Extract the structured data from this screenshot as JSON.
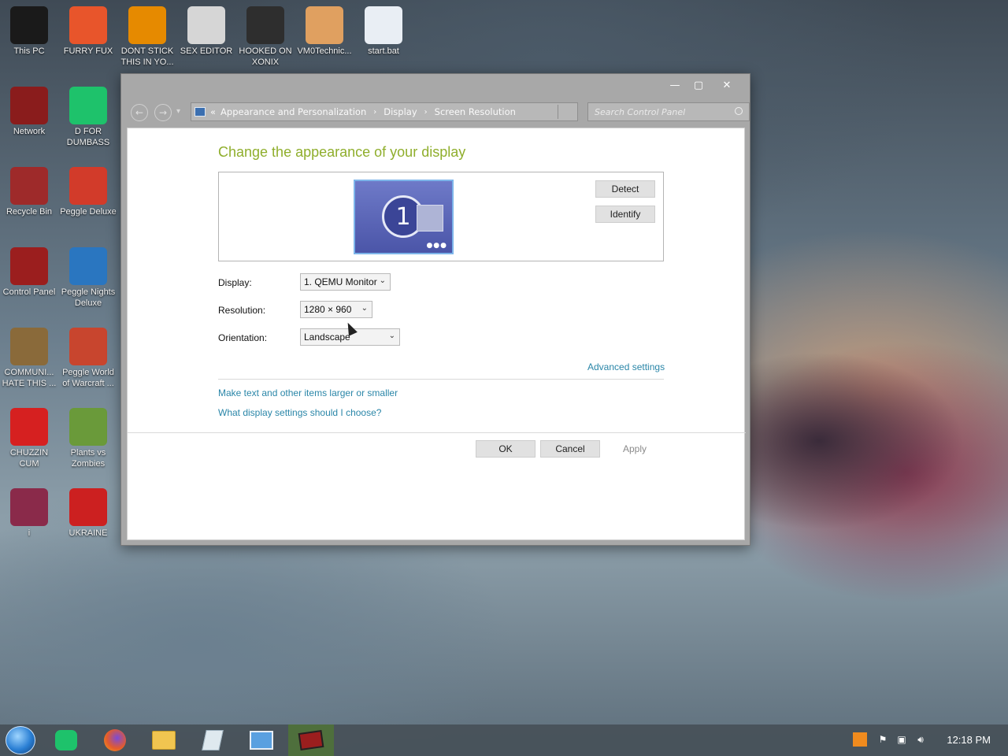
{
  "desktop": {
    "icons": [
      {
        "label": "This PC",
        "icon": "computer-icon",
        "color": "#1a1a1a"
      },
      {
        "label": "FURRY FUX",
        "icon": "firefox-icon",
        "color": "#e8552b"
      },
      {
        "label": "DONT STICK THIS IN YO...",
        "icon": "vlc-cone-icon",
        "color": "#e68a00"
      },
      {
        "label": "SEX EDITOR",
        "icon": "hxd-icon",
        "color": "#d6d6d6"
      },
      {
        "label": "HOOKED ON XONIX",
        "icon": "xonix-icon",
        "color": "#2e2e2e"
      },
      {
        "label": "VM0Technic...",
        "icon": "doctor-icon",
        "color": "#e0a060"
      },
      {
        "label": "start.bat",
        "icon": "gears-icon",
        "color": "#e9eef4"
      },
      {
        "label": "Network",
        "icon": "network-globe-icon",
        "color": "#8a1c1c"
      },
      {
        "label": "D FOR DUMBASS",
        "icon": "chat-lines-icon",
        "color": "#1ec26b"
      },
      {
        "label": "Recycle Bin",
        "icon": "recycle-bin-icon",
        "color": "#9e2a2a"
      },
      {
        "label": "Peggle Deluxe",
        "icon": "peggle-icon",
        "color": "#d23b2a"
      },
      {
        "label": "Control Panel",
        "icon": "control-panel-icon",
        "color": "#9b1e1e"
      },
      {
        "label": "Peggle Nights Deluxe",
        "icon": "peggle-nights-icon",
        "color": "#2a76c0"
      },
      {
        "label": "COMMUNI... HATE THIS ...",
        "icon": "money-bag-icon",
        "color": "#8a6a3a"
      },
      {
        "label": "Peggle World of Warcraft ...",
        "icon": "peggle-wow-icon",
        "color": "#c8452e"
      },
      {
        "label": "CHUZZIN CUM",
        "icon": "chuzzle-icon",
        "color": "#d62020"
      },
      {
        "label": "Plants vs Zombies",
        "icon": "flower-icon",
        "color": "#6a9a3a"
      },
      {
        "label": "i",
        "icon": "winrar-icon",
        "color": "#8a2a4a"
      },
      {
        "label": "UKRAINE",
        "icon": "radiation-icon",
        "color": "#cc2020"
      }
    ]
  },
  "window": {
    "controls": {
      "minimize": "—",
      "maximize": "▢",
      "close": "✕"
    },
    "nav": {
      "back": "←",
      "forward": "→",
      "recent": "▾"
    },
    "breadcrumb": {
      "overflow": "«",
      "items": [
        "Appearance and Personalization",
        "Display",
        "Screen Resolution"
      ],
      "separator": "›"
    },
    "search_placeholder": "Search Control Panel",
    "content": {
      "title": "Change the appearance of your display",
      "monitor_number": "1",
      "detect_label": "Detect",
      "identify_label": "Identify",
      "display_label": "Display:",
      "display_value": "1. QEMU Monitor",
      "resolution_label": "Resolution:",
      "resolution_value": "1280 × 960",
      "orientation_label": "Orientation:",
      "orientation_value": "Landscape",
      "advanced_link": "Advanced settings",
      "text_size_link": "Make text and other items larger or smaller",
      "help_link": "What display settings should I choose?",
      "ok_label": "OK",
      "cancel_label": "Cancel",
      "apply_label": "Apply"
    }
  },
  "taskbar": {
    "start_icon": "start-orb-icon",
    "pinned": [
      {
        "icon": "chat-lines-icon"
      },
      {
        "icon": "firefox-icon"
      },
      {
        "icon": "file-explorer-icon"
      },
      {
        "icon": "notepad-icon"
      },
      {
        "icon": "remote-desktop-icon"
      },
      {
        "icon": "control-panel-icon",
        "active": true
      }
    ],
    "tray": {
      "items": [
        "java-icon",
        "action-center-flag-icon",
        "network-icon",
        "volume-icon"
      ]
    },
    "clock": "12:18 PM"
  }
}
